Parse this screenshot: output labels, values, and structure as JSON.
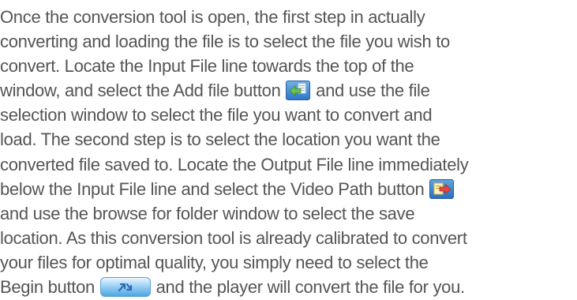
{
  "paragraph": {
    "line1": "Once the conversion tool is open, the first step in actually",
    "line2": "converting and loading the file is to select the file you wish to",
    "line3": "convert. Locate the Input File line towards the top of the",
    "line4_before": "window, and select the Add file button ",
    "line4_after": " and use the file",
    "line5": "selection window to select the file you want to convert and",
    "line6": "load. The second step is to select the location you want the",
    "line7": "converted file saved to. Locate the Output File line immediately",
    "line8_before": "below the Input File line and select the Video Path button ",
    "line8_after": "",
    "line9": "and use the browse for folder window to select the save",
    "line10": "location. As this conversion tool is already calibrated to convert",
    "line11": "your files for optimal quality, you simply need to select the",
    "line12_before": "Begin button ",
    "line12_after": " and the player will convert the file for you."
  },
  "icons": {
    "add_file": "add-file-icon",
    "video_path": "video-path-icon",
    "begin": "begin-icon"
  },
  "colors": {
    "text": "#555555",
    "add_file_arrow": "#6cc24a",
    "video_path_arrow": "#e8453c",
    "begin_arrow": "#2a6fb3"
  }
}
